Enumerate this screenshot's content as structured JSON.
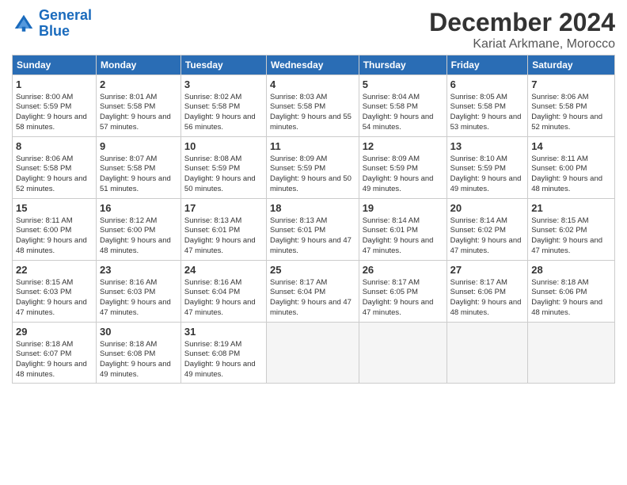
{
  "logo": {
    "line1": "General",
    "line2": "Blue"
  },
  "header": {
    "month": "December 2024",
    "location": "Kariat Arkmane, Morocco"
  },
  "weekdays": [
    "Sunday",
    "Monday",
    "Tuesday",
    "Wednesday",
    "Thursday",
    "Friday",
    "Saturday"
  ],
  "weeks": [
    [
      {
        "day": "1",
        "sunrise": "8:00 AM",
        "sunset": "5:59 PM",
        "daylight": "9 hours and 58 minutes."
      },
      {
        "day": "2",
        "sunrise": "8:01 AM",
        "sunset": "5:58 PM",
        "daylight": "9 hours and 57 minutes."
      },
      {
        "day": "3",
        "sunrise": "8:02 AM",
        "sunset": "5:58 PM",
        "daylight": "9 hours and 56 minutes."
      },
      {
        "day": "4",
        "sunrise": "8:03 AM",
        "sunset": "5:58 PM",
        "daylight": "9 hours and 55 minutes."
      },
      {
        "day": "5",
        "sunrise": "8:04 AM",
        "sunset": "5:58 PM",
        "daylight": "9 hours and 54 minutes."
      },
      {
        "day": "6",
        "sunrise": "8:05 AM",
        "sunset": "5:58 PM",
        "daylight": "9 hours and 53 minutes."
      },
      {
        "day": "7",
        "sunrise": "8:06 AM",
        "sunset": "5:58 PM",
        "daylight": "9 hours and 52 minutes."
      }
    ],
    [
      {
        "day": "8",
        "sunrise": "8:06 AM",
        "sunset": "5:58 PM",
        "daylight": "9 hours and 52 minutes."
      },
      {
        "day": "9",
        "sunrise": "8:07 AM",
        "sunset": "5:58 PM",
        "daylight": "9 hours and 51 minutes."
      },
      {
        "day": "10",
        "sunrise": "8:08 AM",
        "sunset": "5:59 PM",
        "daylight": "9 hours and 50 minutes."
      },
      {
        "day": "11",
        "sunrise": "8:09 AM",
        "sunset": "5:59 PM",
        "daylight": "9 hours and 50 minutes."
      },
      {
        "day": "12",
        "sunrise": "8:09 AM",
        "sunset": "5:59 PM",
        "daylight": "9 hours and 49 minutes."
      },
      {
        "day": "13",
        "sunrise": "8:10 AM",
        "sunset": "5:59 PM",
        "daylight": "9 hours and 49 minutes."
      },
      {
        "day": "14",
        "sunrise": "8:11 AM",
        "sunset": "6:00 PM",
        "daylight": "9 hours and 48 minutes."
      }
    ],
    [
      {
        "day": "15",
        "sunrise": "8:11 AM",
        "sunset": "6:00 PM",
        "daylight": "9 hours and 48 minutes."
      },
      {
        "day": "16",
        "sunrise": "8:12 AM",
        "sunset": "6:00 PM",
        "daylight": "9 hours and 48 minutes."
      },
      {
        "day": "17",
        "sunrise": "8:13 AM",
        "sunset": "6:01 PM",
        "daylight": "9 hours and 47 minutes."
      },
      {
        "day": "18",
        "sunrise": "8:13 AM",
        "sunset": "6:01 PM",
        "daylight": "9 hours and 47 minutes."
      },
      {
        "day": "19",
        "sunrise": "8:14 AM",
        "sunset": "6:01 PM",
        "daylight": "9 hours and 47 minutes."
      },
      {
        "day": "20",
        "sunrise": "8:14 AM",
        "sunset": "6:02 PM",
        "daylight": "9 hours and 47 minutes."
      },
      {
        "day": "21",
        "sunrise": "8:15 AM",
        "sunset": "6:02 PM",
        "daylight": "9 hours and 47 minutes."
      }
    ],
    [
      {
        "day": "22",
        "sunrise": "8:15 AM",
        "sunset": "6:03 PM",
        "daylight": "9 hours and 47 minutes."
      },
      {
        "day": "23",
        "sunrise": "8:16 AM",
        "sunset": "6:03 PM",
        "daylight": "9 hours and 47 minutes."
      },
      {
        "day": "24",
        "sunrise": "8:16 AM",
        "sunset": "6:04 PM",
        "daylight": "9 hours and 47 minutes."
      },
      {
        "day": "25",
        "sunrise": "8:17 AM",
        "sunset": "6:04 PM",
        "daylight": "9 hours and 47 minutes."
      },
      {
        "day": "26",
        "sunrise": "8:17 AM",
        "sunset": "6:05 PM",
        "daylight": "9 hours and 47 minutes."
      },
      {
        "day": "27",
        "sunrise": "8:17 AM",
        "sunset": "6:06 PM",
        "daylight": "9 hours and 48 minutes."
      },
      {
        "day": "28",
        "sunrise": "8:18 AM",
        "sunset": "6:06 PM",
        "daylight": "9 hours and 48 minutes."
      }
    ],
    [
      {
        "day": "29",
        "sunrise": "8:18 AM",
        "sunset": "6:07 PM",
        "daylight": "9 hours and 48 minutes."
      },
      {
        "day": "30",
        "sunrise": "8:18 AM",
        "sunset": "6:08 PM",
        "daylight": "9 hours and 49 minutes."
      },
      {
        "day": "31",
        "sunrise": "8:19 AM",
        "sunset": "6:08 PM",
        "daylight": "9 hours and 49 minutes."
      },
      null,
      null,
      null,
      null
    ]
  ]
}
